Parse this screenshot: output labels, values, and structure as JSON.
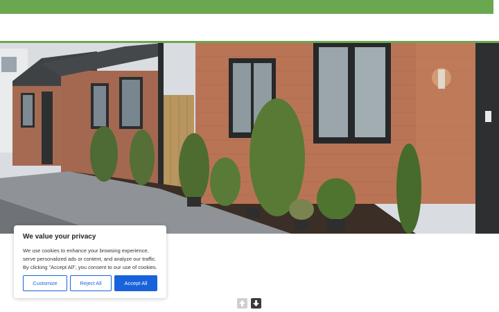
{
  "cookie_banner": {
    "title": "We value your privacy",
    "body": "We use cookies to enhance your browsing experience, serve personalized ads or content, and analyze our traffic. By clicking \"Accept All\", you consent to our use of cookies.",
    "customize_label": "Customize",
    "reject_label": "Reject All",
    "accept_label": "Accept All"
  },
  "icons": {
    "scroll_up": "arrow-up-icon",
    "scroll_down": "arrow-down-icon"
  },
  "colors": {
    "brand_green": "#6aa84f",
    "button_blue": "#1863dc"
  }
}
